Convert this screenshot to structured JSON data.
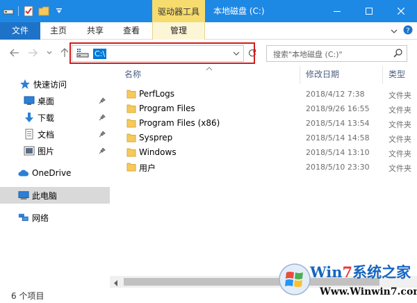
{
  "window": {
    "context_tab": "驱动器工具",
    "title": "本地磁盘 (C:)",
    "colors": {
      "titlebar": "#1e88e5",
      "accent": "#0078d7",
      "context_tab": "#f6dc6e",
      "highlight_box": "#d21c1c",
      "folder": "#f7c95c"
    }
  },
  "ribbon": {
    "tabs": [
      "文件",
      "主页",
      "共享",
      "查看",
      "管理"
    ]
  },
  "address": {
    "path": "C:\\",
    "search_placeholder": "搜索\"本地磁盘 (C:)\""
  },
  "sidebar": {
    "quick_access": "快速访问",
    "items": [
      {
        "label": "桌面",
        "icon": "desktop-icon",
        "pinned": true
      },
      {
        "label": "下载",
        "icon": "download-icon",
        "pinned": true
      },
      {
        "label": "文档",
        "icon": "document-icon",
        "pinned": true
      },
      {
        "label": "图片",
        "icon": "picture-icon",
        "pinned": true
      }
    ],
    "onedrive": "OneDrive",
    "this_pc": "此电脑",
    "network": "网络"
  },
  "columns": {
    "name": "名称",
    "date": "修改日期",
    "type": "类型"
  },
  "files": [
    {
      "name": "PerfLogs",
      "date": "2018/4/12 7:38",
      "type": "文件夹"
    },
    {
      "name": "Program Files",
      "date": "2018/9/26 16:55",
      "type": "文件夹"
    },
    {
      "name": "Program Files (x86)",
      "date": "2018/5/14 13:54",
      "type": "文件夹"
    },
    {
      "name": "Sysprep",
      "date": "2018/5/14 14:58",
      "type": "文件夹"
    },
    {
      "name": "Windows",
      "date": "2018/5/14 13:10",
      "type": "文件夹"
    },
    {
      "name": "用户",
      "date": "2018/5/10 23:30",
      "type": "文件夹"
    }
  ],
  "status": {
    "item_count": "6 个项目"
  },
  "watermark": {
    "brand": "Win7系统之家",
    "url": "Www.Winwin7.com"
  }
}
